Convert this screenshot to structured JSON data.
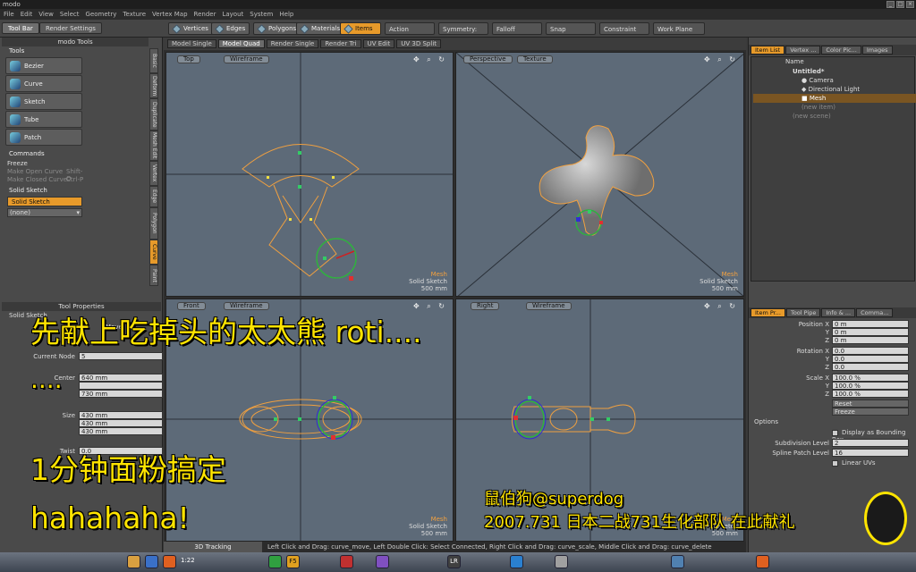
{
  "window": {
    "title": "modo"
  },
  "menu": [
    "File",
    "Edit",
    "View",
    "Select",
    "Geometry",
    "Texture",
    "Vertex Map",
    "Render",
    "Layout",
    "System",
    "Help"
  ],
  "toolbar": {
    "tabs": [
      {
        "label": "Tool Bar"
      },
      {
        "label": "Render Settings"
      }
    ],
    "modes": [
      {
        "label": "Vertices"
      },
      {
        "label": "Edges"
      },
      {
        "label": "Polygons"
      },
      {
        "label": "Materials"
      },
      {
        "label": "Items"
      }
    ],
    "active_mode": "Items",
    "dropdowns": [
      {
        "label": "Action Center"
      },
      {
        "label": "Symmetry: Off"
      },
      {
        "label": "Falloff"
      },
      {
        "label": "Snap"
      },
      {
        "label": "Constraint"
      },
      {
        "label": "Work Plane"
      }
    ]
  },
  "leftpanel": {
    "header": "modo Tools",
    "tools_title": "Tools",
    "tools": [
      "Bezier",
      "Curve",
      "Sketch",
      "Tube",
      "Patch"
    ],
    "commands_title": "Commands",
    "commands": [
      {
        "label": "Freeze",
        "shortcut": "",
        "enabled": true
      },
      {
        "label": "Make Open Curve",
        "shortcut": "Shift-O",
        "enabled": false
      },
      {
        "label": "Make Closed Curve",
        "shortcut": "Ctrl-P",
        "enabled": false
      }
    ],
    "solid_title": "Solid Sketch",
    "solid_button": "Solid Sketch",
    "solid_select": "(none)",
    "vtabs": [
      "Basic",
      "Deform",
      "Duplicate",
      "Mesh Edit",
      "Vertex",
      "Edge",
      "Polygon",
      "Curve",
      "Paint"
    ],
    "active_vtab": "Curve",
    "props_header": "Tool Properties",
    "props_title": "Solid Sketch",
    "props_mode": "Move",
    "current_node_label": "Current Node",
    "current_node": "5",
    "center_label": "Center",
    "center": {
      "x": "640 mm",
      "y": "",
      "z": "730 mm"
    },
    "size_label": "Size",
    "size": {
      "x": "430 mm",
      "y": "430 mm",
      "z": "430 mm"
    },
    "twist_label": "Twist",
    "twist": "0.0"
  },
  "viewports": {
    "tabs": [
      "Model Single",
      "Model Quad",
      "Render Single",
      "Render Tri",
      "UV Edit",
      "UV 3D Split"
    ],
    "active_tab": "Model Quad",
    "panes": [
      {
        "view": "Top",
        "shade": "Wireframe",
        "info": [
          "Mesh",
          "Solid Sketch",
          "500 mm"
        ]
      },
      {
        "view": "Perspective",
        "shade": "Texture",
        "info": [
          "Mesh",
          "Solid Sketch",
          "500 mm"
        ]
      },
      {
        "view": "Front",
        "shade": "Wireframe",
        "info": [
          "Mesh",
          "Solid Sketch",
          "500 mm"
        ]
      },
      {
        "view": "Right",
        "shade": "Wireframe",
        "info": [
          "Mesh",
          "Solid Sketch",
          "500 mm"
        ]
      }
    ],
    "nav_icons": "✥ ⌕ ↻"
  },
  "status": {
    "track": "3D Tracking",
    "text": "Left Click and Drag: curve_move,  Left Double Click: Select Connected,  Right Click and Drag: curve_scale,  Middle Click and Drag: curve_delete"
  },
  "rightpanel": {
    "tabs": [
      "Item List",
      "Vertex ...",
      "Color Pic...",
      "Images"
    ],
    "active_tab": "Item List",
    "name_col": "Name",
    "items": [
      {
        "label": "Untitled*",
        "level": 0,
        "selected": false,
        "dim": false
      },
      {
        "label": "Camera",
        "level": 1,
        "selected": false,
        "dim": false
      },
      {
        "label": "Directional Light",
        "level": 1,
        "selected": false,
        "dim": false
      },
      {
        "label": "Mesh",
        "level": 1,
        "selected": true,
        "dim": false
      },
      {
        "label": "(new item)",
        "level": 1,
        "selected": false,
        "dim": true
      },
      {
        "label": "(new scene)",
        "level": 0,
        "selected": false,
        "dim": true
      }
    ],
    "prop_tabs": [
      "Item Pr...",
      "Tool Pipe",
      "Info & ...",
      "Comma..."
    ],
    "active_prop_tab": "Item Pr...",
    "position_label": "Position",
    "position": [
      "0 m",
      "0 m",
      "0 m"
    ],
    "rotation_label": "Rotation",
    "rotation": [
      "0.0",
      "0.0",
      "0.0"
    ],
    "scale_label": "Scale",
    "scale": [
      "100.0 %",
      "100.0 %",
      "100.0 %"
    ],
    "axis_x": "X",
    "axis_y": "Y",
    "axis_z": "Z",
    "reset": "Reset",
    "freeze": "Freeze",
    "options_title": "Options",
    "display_bbox": "Display as Bounding Box",
    "subdiv_label": "Subdivision Level",
    "subdiv": "2",
    "spline_label": "Spline Patch Level",
    "spline": "16",
    "linear_uvs": "Linear UVs"
  },
  "overlay": {
    "line1": "先献上吃掉头的太太熊 roti....",
    "line2": "....",
    "line3": "1分钟面粉搞定",
    "line4": "hahahaha!",
    "credit1": "鼠伯狗@superdog",
    "credit2": "2007.731 日本二战731生化部队 在此献礼"
  },
  "taskbar": {
    "clock": "1:22",
    "apps": [
      "F5",
      "LR"
    ]
  },
  "colors": {
    "accent": "#e79a2a",
    "viewport": "#5d6a78",
    "curve": "#f0a040",
    "overlay_text": "#ffe400"
  }
}
